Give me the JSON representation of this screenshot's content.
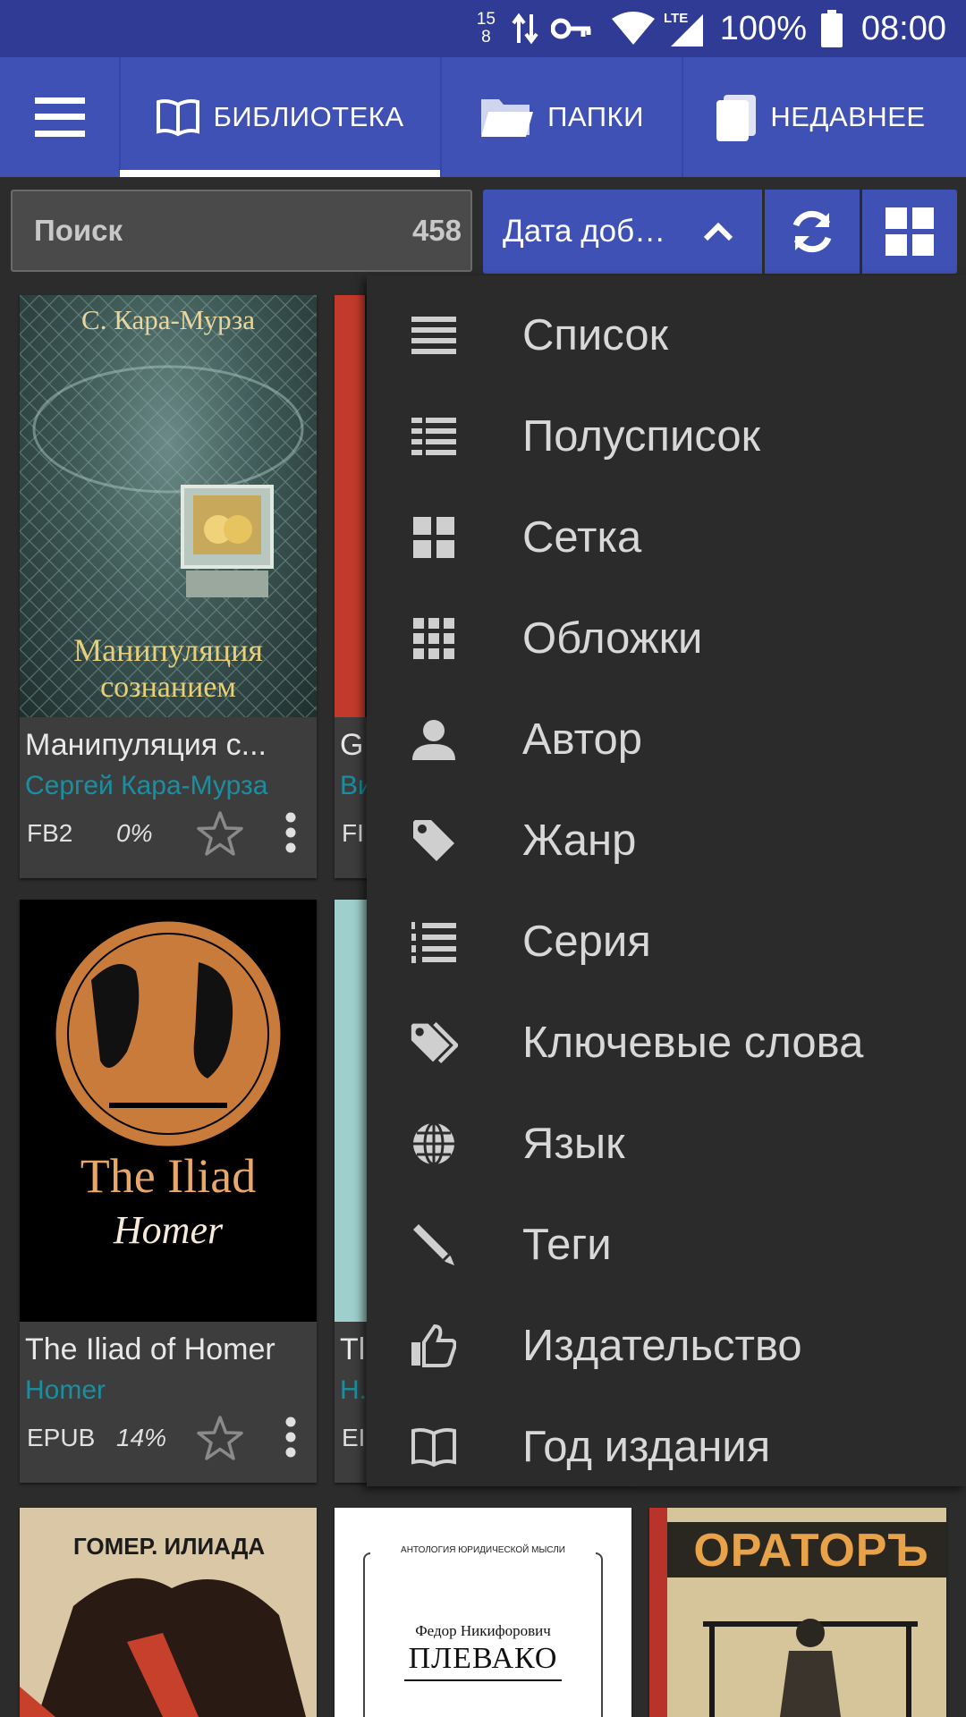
{
  "status_bar": {
    "speed_top": "15",
    "speed_bottom": "8",
    "network": "LTE",
    "battery": "100%",
    "time": "08:00"
  },
  "tabs": [
    {
      "label": "БИБЛИОТЕКА",
      "icon": "open-book-icon",
      "active": true
    },
    {
      "label": "ПАПКИ",
      "icon": "folder-icon",
      "active": false
    },
    {
      "label": "НЕДАВНЕЕ",
      "icon": "recent-books-icon",
      "active": false
    }
  ],
  "search": {
    "label": "Поиск",
    "count": "458"
  },
  "sort": {
    "label": "Дата доб…",
    "direction": "ascending"
  },
  "colors": {
    "primary": "#3f51b5",
    "status_bar": "#2f3b95",
    "author": "#1a8fa2",
    "background": "#2c2c2c",
    "menu": "#2b2b2b"
  },
  "books": [
    {
      "title": "Манипуляция с...",
      "author": "Сергей Кара-Мурза",
      "format": "FB2",
      "progress": "0%",
      "cover_author": "С. Кара-Мурза",
      "cover_title_1": "Манипуляция",
      "cover_title_2": "сознанием"
    },
    {
      "title": "The Iliad of Homer",
      "author": "Homer",
      "format": "EPUB",
      "progress": "14%",
      "cover_title": "The Iliad",
      "cover_subtitle": "Homer"
    }
  ],
  "partial_books": [
    {
      "title_start": "G",
      "author_start": "Ви",
      "format_start": "FI"
    },
    {
      "title_start": "Tl",
      "author_start": "H.",
      "format_start": "EI"
    }
  ],
  "bottom_covers": [
    {
      "text": "ГОМЕР. ИЛИАДА"
    },
    {
      "header": "АНТОЛОГИЯ ЮРИДИЧЕСКОЙ МЫСЛИ",
      "author": "Федор Никифорович",
      "title": "ПЛЕВАКО"
    },
    {
      "text": "ОРАТОРЪ"
    }
  ],
  "view_menu": [
    {
      "label": "Список",
      "icon": "list-icon"
    },
    {
      "label": "Полусписок",
      "icon": "half-list-icon"
    },
    {
      "label": "Сетка",
      "icon": "grid-icon"
    },
    {
      "label": "Обложки",
      "icon": "covers-grid-icon"
    },
    {
      "label": "Автор",
      "icon": "person-icon"
    },
    {
      "label": "Жанр",
      "icon": "tag-icon"
    },
    {
      "label": "Серия",
      "icon": "numbered-list-icon"
    },
    {
      "label": "Ключевые слова",
      "icon": "tags-icon"
    },
    {
      "label": "Язык",
      "icon": "globe-icon"
    },
    {
      "label": "Теги",
      "icon": "pencil-icon"
    },
    {
      "label": "Издательство",
      "icon": "thumbs-up-icon"
    },
    {
      "label": "Год издания",
      "icon": "book-icon"
    }
  ]
}
